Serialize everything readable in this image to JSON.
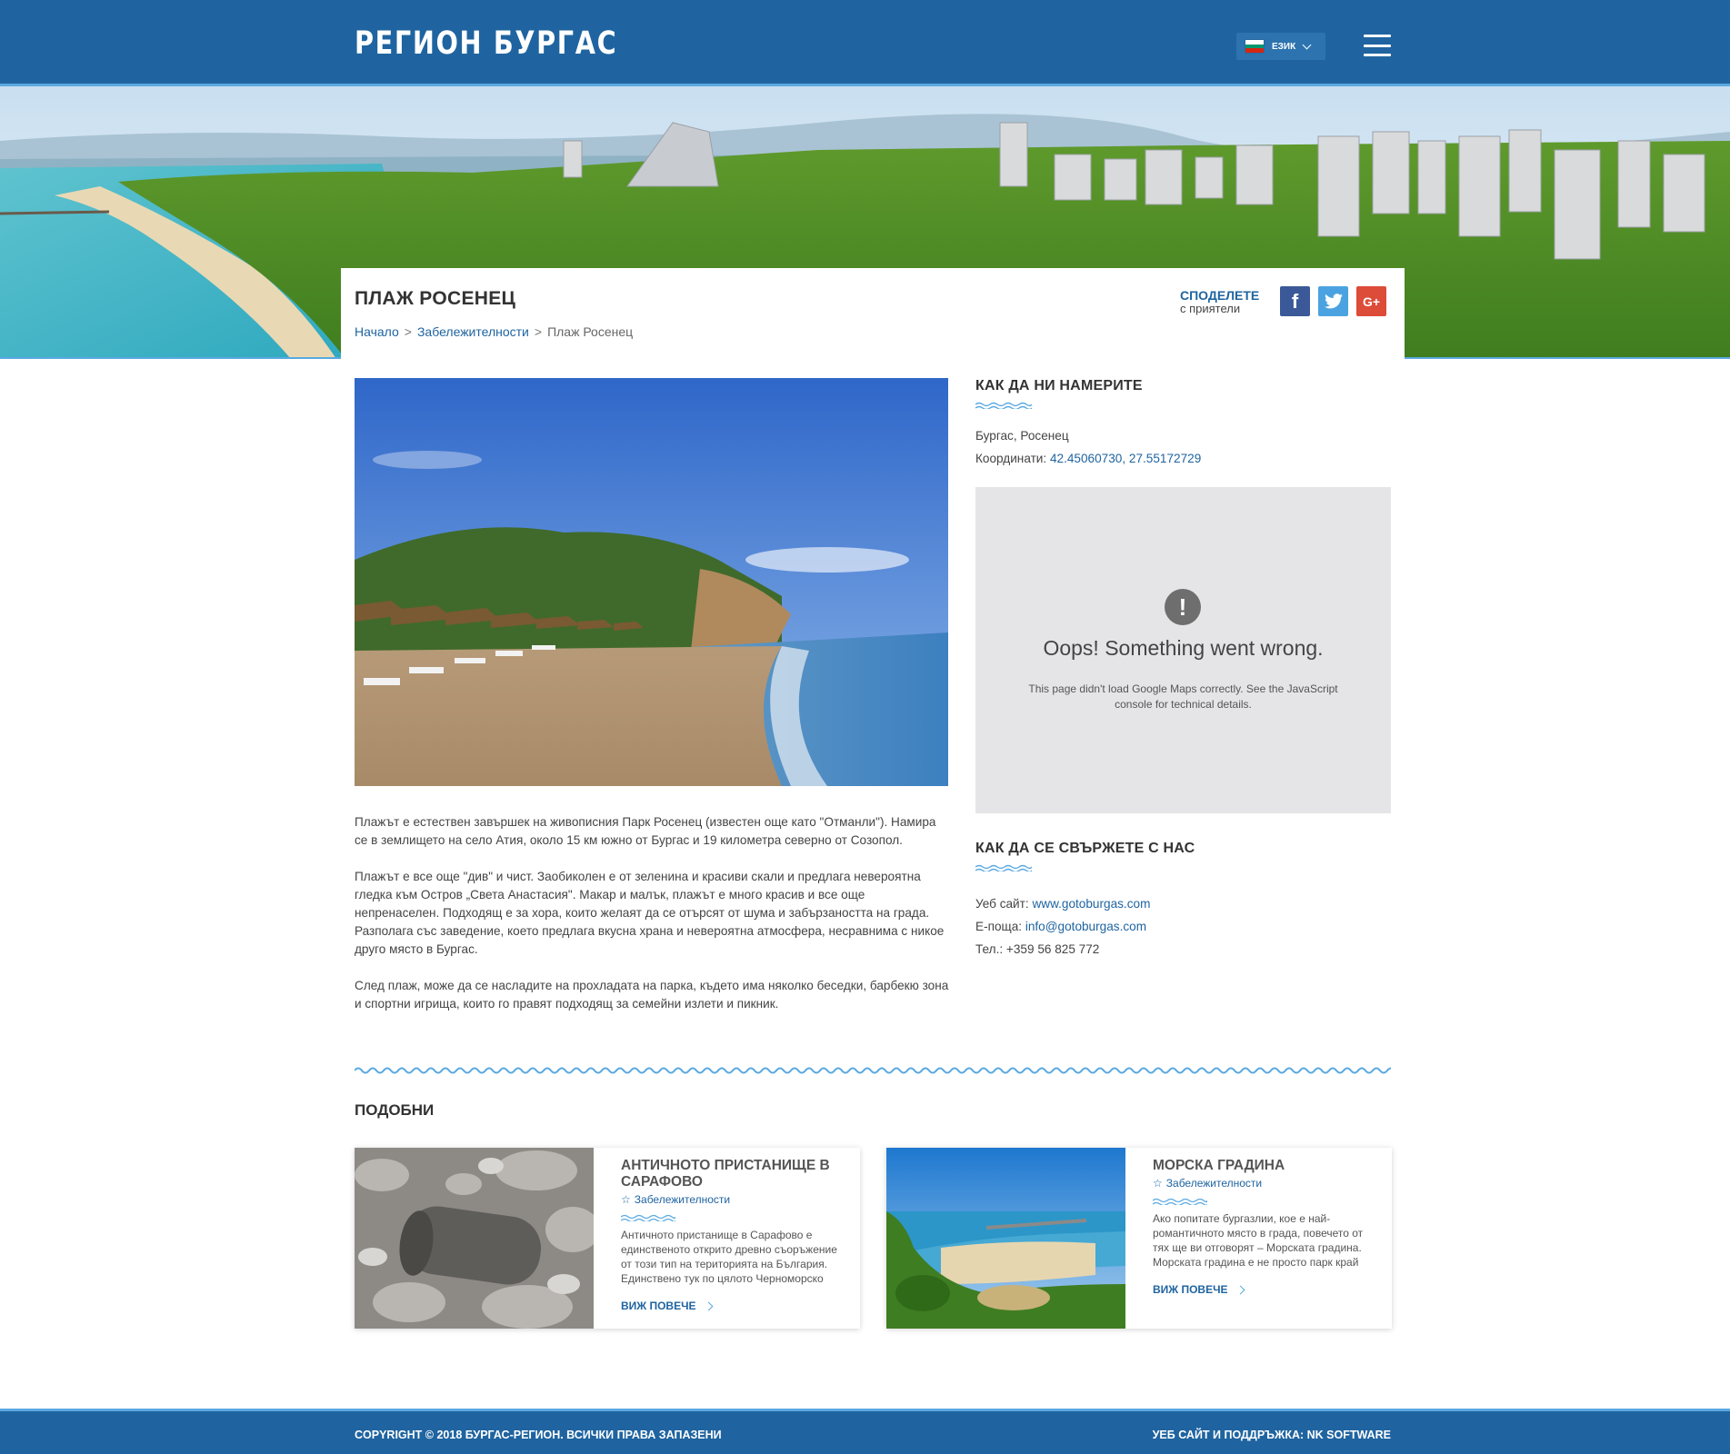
{
  "header": {
    "logo": "РЕГИОН БУРГАС",
    "language_label": "ЕЗИК",
    "flag_colors": [
      "#ffffff",
      "#00966e",
      "#d62612"
    ]
  },
  "page": {
    "title": "ПЛАЖ РОСЕНЕЦ",
    "breadcrumb": [
      "Начало",
      "Забележителности",
      "Плаж Росенец"
    ],
    "breadcrumb_separator": ">"
  },
  "share": {
    "title": "СПОДЕЛЕТЕ",
    "subtitle": "с приятели",
    "icons": [
      "facebook-icon",
      "twitter-icon",
      "google-plus-icon"
    ],
    "facebook": "f",
    "google": "G+"
  },
  "description": [
    "Плажът е естествен завършек на живописния Парк Росенец (известен още като \"Отманли\"). Намира се в землището на село Атия, около 15 км южно от Бургас и 19 километра северно от Созопол.",
    "Плажът е все още \"див\" и чист. Заобиколен е от зеленина и красиви скали и предлага невероятна гледка към Остров „Света Анастасия\". Макар и малък, плажът е много красив и все още непренаселен. Подходящ е за хора, които желаят да се отърсят от шума и забързаността на града. Разполага със заведение, което предлага вкусна храна и невероятна атмосфера, несравнима с никое друго място в Бургас.",
    "След плаж, може да се насладите на прохладата на парка, където има няколко беседки, барбекю зона и спортни игрища, които го правят подходящ за семейни излети и пикник."
  ],
  "find_us": {
    "heading": "КАК ДА НИ НАМЕРИТЕ",
    "address": "Бургас, Росенец",
    "coords_label": "Координати:",
    "coords_value": "42.45060730, 27.55172729"
  },
  "map": {
    "icon": "!",
    "error_title": "Oops! Something went wrong.",
    "error_message": "This page didn't load Google Maps correctly. See the JavaScript console for technical details."
  },
  "contact": {
    "heading": "КАК ДА СЕ СВЪРЖЕТЕ С НАС",
    "website_label": "Уеб сайт:",
    "website": "www.gotoburgas.com",
    "email_label": "Е-поща:",
    "email": "info@gotoburgas.com",
    "phone_label": "Тел.:",
    "phone": "+359 56 825 772"
  },
  "similar": {
    "heading": "ПОДОБНИ",
    "cards": [
      {
        "title": "АНТИЧНОТО ПРИСТАНИЩЕ В САРАФОВО",
        "category": "Забележителности",
        "text": "Античното пристанище в Сарафово е единственото открито древно съоръжение от този тип на територията на България. Единствено тук по цялото Черноморско",
        "more": "ВИЖ ПОВЕЧЕ"
      },
      {
        "title": "МОРСКА ГРАДИНА",
        "category": "Забележителности",
        "text": "Ако попитате бургазлии, кое е най-романтичното място в града, повечето от тях ще ви отговорят – Морската градина. Морската градина е не просто парк край",
        "more": "ВИЖ ПОВЕЧЕ"
      }
    ]
  },
  "footer": {
    "left": "COPYRIGHT © 2018 БУРГАС-РЕГИОН. ВСИЧКИ ПРАВА ЗАПАЗЕНИ",
    "right": "УЕБ САЙТ И ПОДДРЪЖКА: NK SOFTWARE"
  },
  "colors": {
    "brand_blue": "#1f64a0",
    "accent_light_blue": "#5aa9e0",
    "map_bg": "#e5e5e8"
  }
}
